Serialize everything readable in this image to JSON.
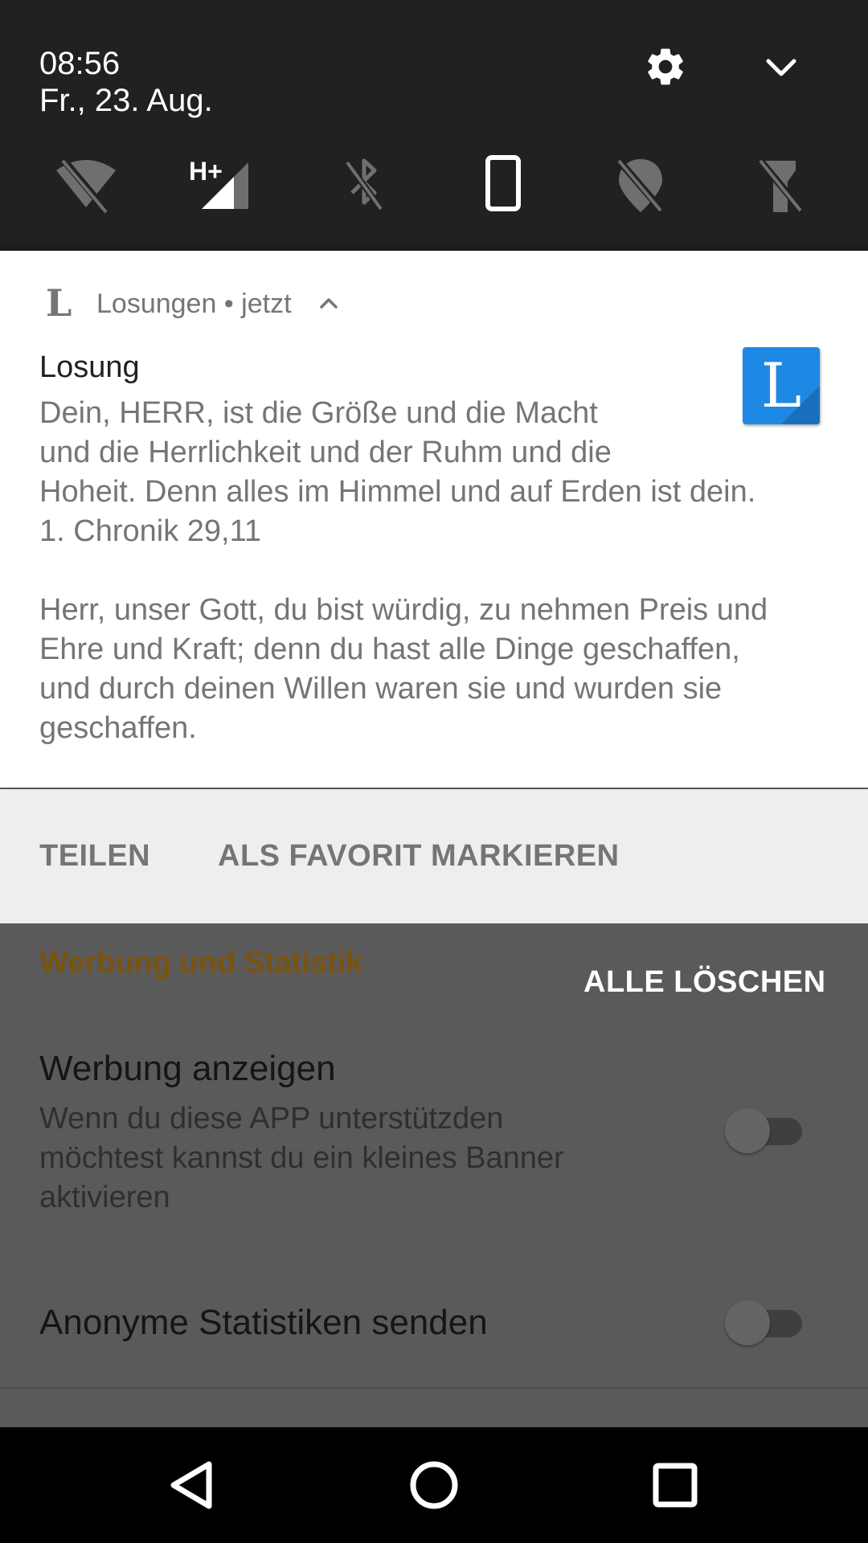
{
  "status": {
    "time": "08:56",
    "date": "Fr., 23. Aug."
  },
  "quick_settings": {
    "tiles": [
      {
        "icon": "wifi-off-icon",
        "label": "H+"
      },
      {
        "icon": "mobile-signal-icon",
        "label": "H+"
      },
      {
        "icon": "bluetooth-off-icon"
      },
      {
        "icon": "auto-rotate-icon"
      },
      {
        "icon": "location-off-icon"
      },
      {
        "icon": "flashlight-off-icon"
      }
    ],
    "network_type": "H+"
  },
  "notification": {
    "app_glyph": "L",
    "app_name": "Losungen • jetzt",
    "title": "Losung",
    "large_icon_letter": "L",
    "large_icon_color": "#1e88e5",
    "body_losung": [
      "Dein, HERR, ist die Größe und die Macht",
      "und die Herrlichkeit und der Ruhm und die",
      "Hoheit. Denn alles im Himmel und auf Erden ist dein.",
      "1. Chronik 29,11"
    ],
    "body_lehrtext": [
      "Herr, unser Gott, du bist würdig, zu nehmen Preis und",
      "Ehre und Kraft; denn du hast alle Dinge geschaffen,",
      "und durch deinen Willen waren sie und wurden sie",
      "geschaffen."
    ],
    "actions": {
      "share": "TEILEN",
      "favorite": "ALS FAVORIT MARKIEREN"
    }
  },
  "shade": {
    "clear_all": "ALLE LÖSCHEN"
  },
  "settings": {
    "section_title": "Werbung und Statistik",
    "section_color": "#7a5310",
    "ads": {
      "title": "Werbung anzeigen",
      "summary": [
        "Wenn du diese APP unterstützden",
        "möchtest kannst du ein kleines Banner",
        "aktivieren"
      ],
      "enabled": false
    },
    "stats": {
      "title": "Anonyme Statistiken senden",
      "enabled": false
    }
  },
  "navbar": {
    "back": "back-icon",
    "home": "home-icon",
    "recents": "recents-icon"
  }
}
